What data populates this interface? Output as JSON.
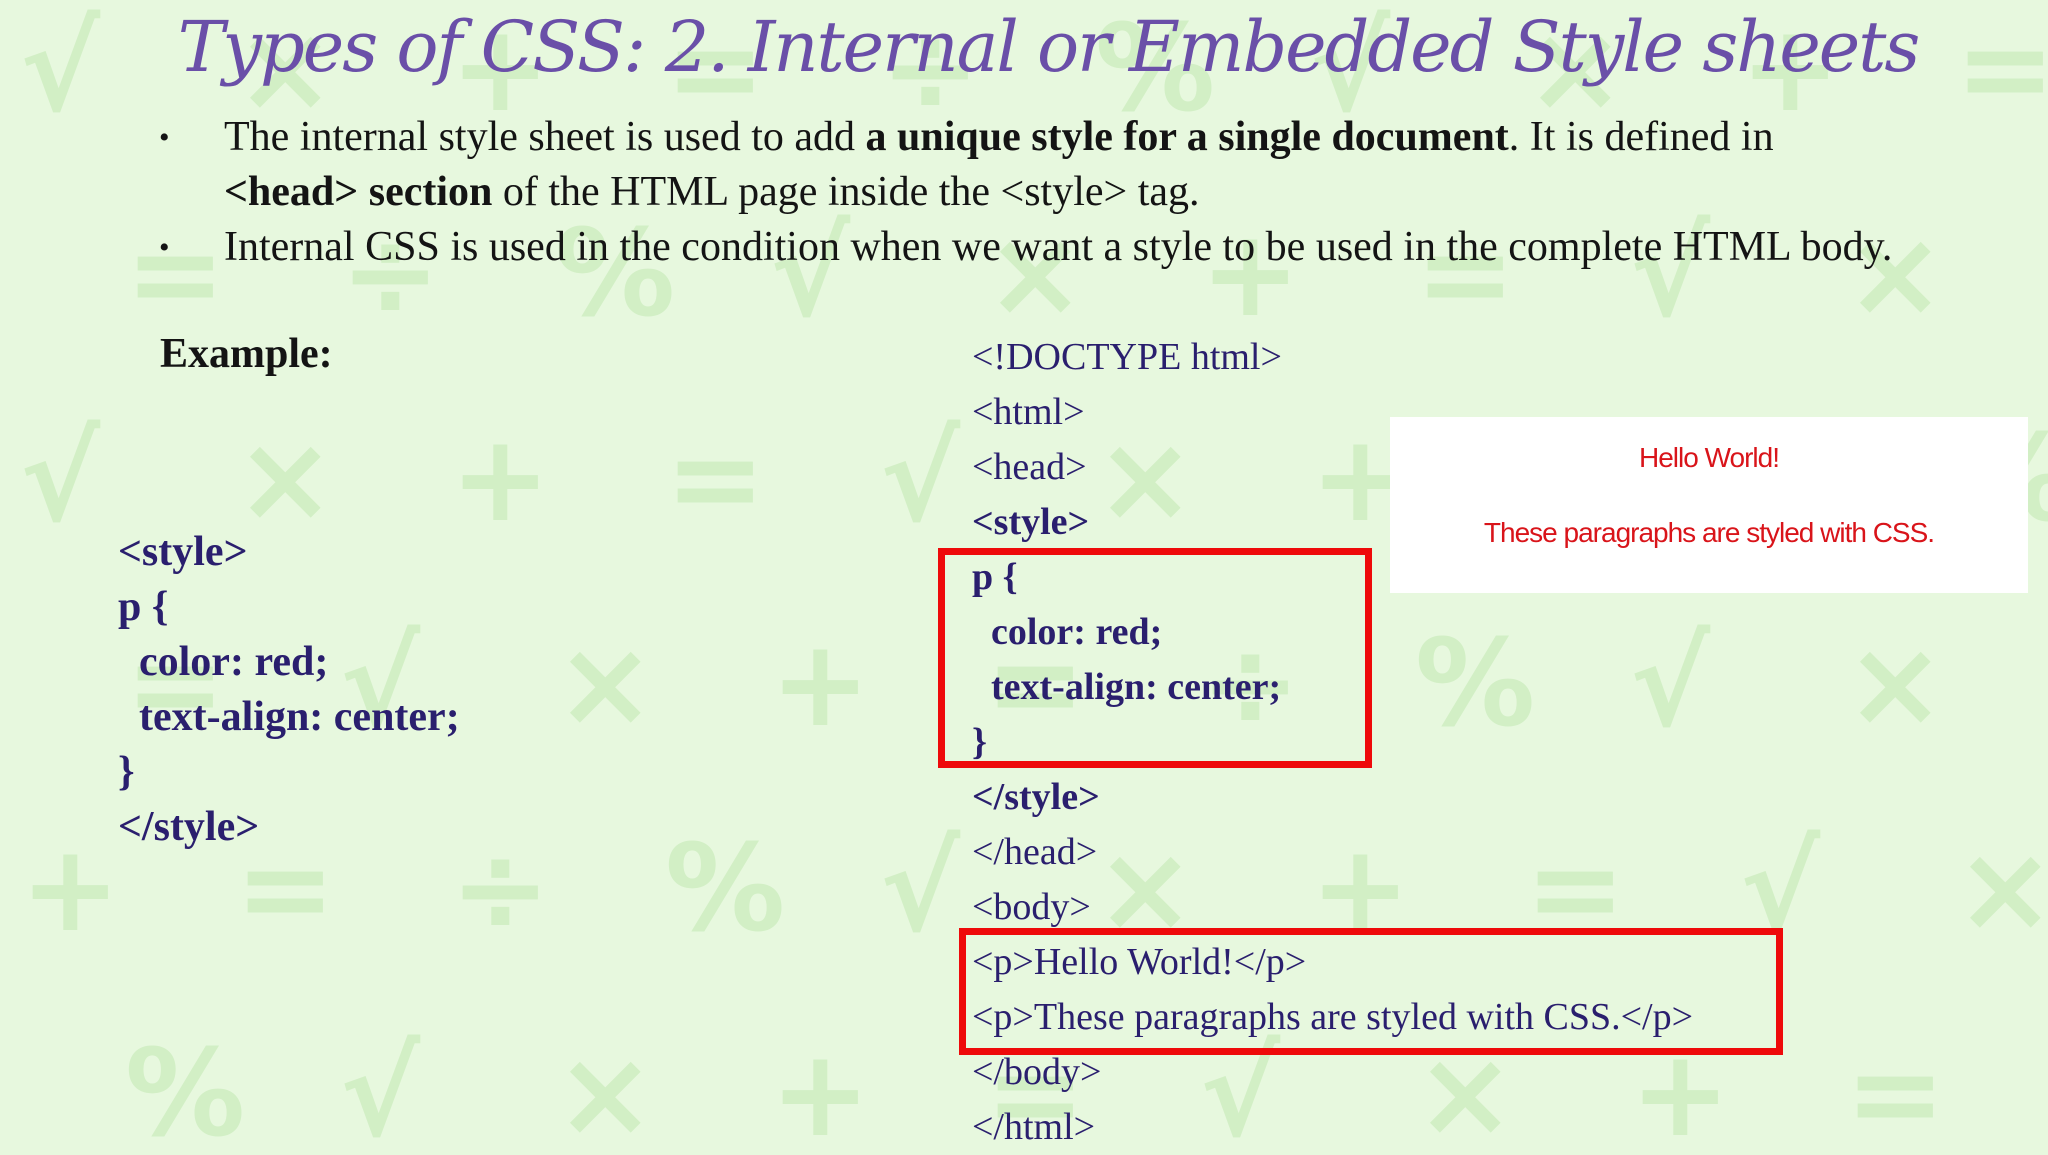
{
  "slide": {
    "title": "Types of CSS: 2. Internal or Embedded Style sheets",
    "bullet_char": "•",
    "bullets": [
      {
        "t1": "The internal style sheet is used to add ",
        "b1": "a unique style for a single document",
        "t2": ". It is defined in ",
        "b2": "<head> section",
        "t3": " of the HTML page inside the <style> tag."
      },
      {
        "t1": "Internal CSS is used in the condition when we want a style to be used in the complete HTML body."
      }
    ],
    "example_label": "Example:",
    "left_code": [
      "<style>",
      "p {",
      "  color: red;",
      "  text-align: center;",
      "}",
      "</style>"
    ],
    "right_code": [
      "<!DOCTYPE html>",
      "<html>",
      "<head>",
      "<style>",
      "p {",
      "  color: red;",
      "  text-align: center;",
      "}",
      "</style>",
      "</head>",
      "<body>",
      "<p>Hello World!</p>",
      "<p>These paragraphs are styled with CSS.</p>",
      "</body>",
      "</html>"
    ],
    "preview": {
      "line1": "Hello World!",
      "line2": "These paragraphs are styled with CSS."
    },
    "colors": {
      "title": "#6a4fa8",
      "code": "#2a1f6e",
      "highlight": "#ee0a0a",
      "preview_text": "#d9141a",
      "background": "#e7f8de"
    }
  }
}
